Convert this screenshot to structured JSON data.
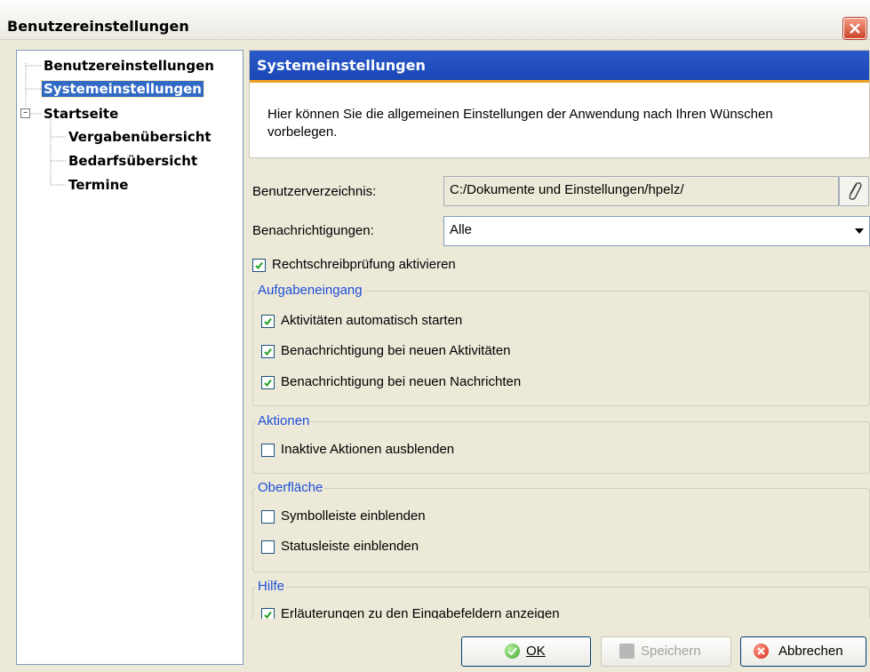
{
  "window": {
    "title": "Benutzereinstellungen"
  },
  "tree": {
    "items": [
      {
        "label": "Benutzereinstellungen"
      },
      {
        "label": "Systemeinstellungen"
      },
      {
        "label": "Startseite"
      },
      {
        "label": "Vergabenübersicht"
      },
      {
        "label": "Bedarfsübersicht"
      },
      {
        "label": "Termine"
      }
    ],
    "selected": "Systemeinstellungen"
  },
  "panel": {
    "title": "Systemeinstellungen",
    "description": "Hier können Sie die allgemeinen Einstellungen der Anwendung nach Ihren Wünschen vorbelegen."
  },
  "fields": {
    "user_dir_label": "Benutzerverzeichnis:",
    "user_dir_value": "C:/Dokumente und Einstellungen/hpelz/",
    "notifications_label": "Benachrichtigungen:",
    "notifications_value": "Alle",
    "spellcheck_label": "Rechtschreibprüfung aktivieren",
    "spellcheck_checked": true
  },
  "groups": {
    "aufgabeneingang": {
      "title": "Aufgabeneingang",
      "items": [
        {
          "label": "Aktivitäten automatisch starten",
          "checked": true
        },
        {
          "label": "Benachrichtigung bei neuen Aktivitäten",
          "checked": true
        },
        {
          "label": "Benachrichtigung bei neuen Nachrichten",
          "checked": true
        }
      ]
    },
    "aktionen": {
      "title": "Aktionen",
      "items": [
        {
          "label": "Inaktive Aktionen ausblenden",
          "checked": false
        }
      ]
    },
    "oberflaeche": {
      "title": "Oberfläche",
      "items": [
        {
          "label": "Symbolleiste einblenden",
          "checked": false
        },
        {
          "label": "Statusleiste einblenden",
          "checked": false
        }
      ]
    },
    "hilfe": {
      "title": "Hilfe",
      "items": [
        {
          "label": "Erläuterungen zu den Eingabefeldern anzeigen",
          "checked": true
        }
      ]
    }
  },
  "buttons": {
    "ok": "OK",
    "save": "Speichern",
    "cancel": "Abbrechen"
  },
  "colors": {
    "accent": "#1e4fd8",
    "header": "#2a59c9",
    "selection": "#316AC5"
  }
}
